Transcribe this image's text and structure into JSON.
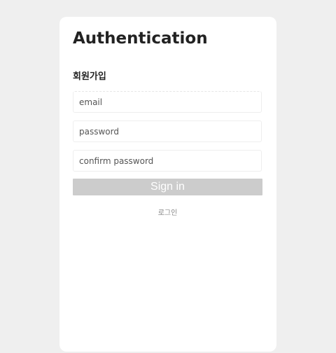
{
  "page": {
    "title": "Authentication"
  },
  "signup_form": {
    "heading": "회원가입",
    "email_placeholder": "email",
    "password_placeholder": "password",
    "confirm_password_placeholder": "confirm password",
    "submit_label": "Sign in",
    "login_link_label": "로그인"
  },
  "colors": {
    "background": "#efefef",
    "card": "#ffffff",
    "button_disabled": "#cccccc",
    "text_primary": "#222222",
    "text_muted": "#888888"
  }
}
